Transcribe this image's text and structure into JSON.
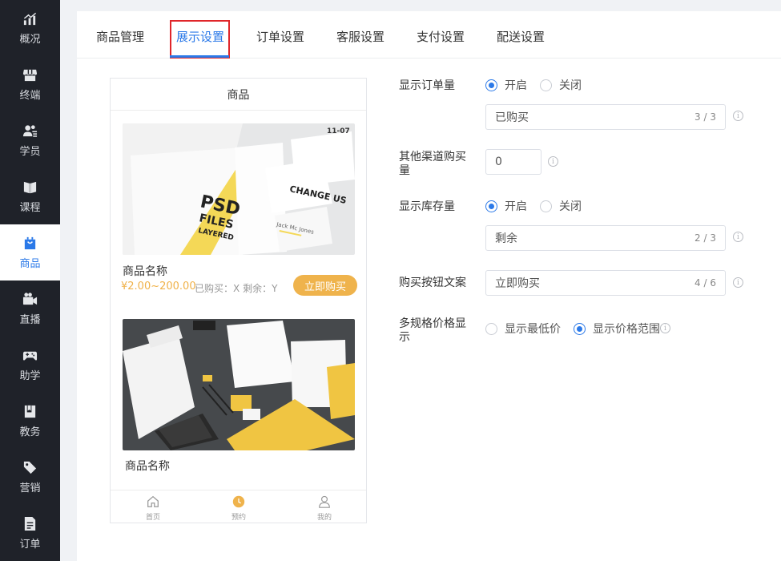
{
  "sidebar": {
    "items": [
      {
        "label": "概况",
        "icon": "chart-icon"
      },
      {
        "label": "终端",
        "icon": "store-icon"
      },
      {
        "label": "学员",
        "icon": "users-icon"
      },
      {
        "label": "课程",
        "icon": "book-icon"
      },
      {
        "label": "商品",
        "icon": "shopping-bag-icon",
        "active": true
      },
      {
        "label": "直播",
        "icon": "video-camera-icon"
      },
      {
        "label": "助学",
        "icon": "gamepad-icon"
      },
      {
        "label": "教务",
        "icon": "notebook-icon"
      },
      {
        "label": "营销",
        "icon": "tag-icon"
      },
      {
        "label": "订单",
        "icon": "document-icon"
      }
    ]
  },
  "tabs": [
    {
      "label": "商品管理"
    },
    {
      "label": "展示设置",
      "active": true
    },
    {
      "label": "订单设置"
    },
    {
      "label": "客服设置"
    },
    {
      "label": "支付设置"
    },
    {
      "label": "配送设置"
    }
  ],
  "preview": {
    "header": "商品",
    "products": [
      {
        "name": "商品名称",
        "price": "¥2.00~200.00",
        "sold": "已购买：X",
        "remaining": "剩余：Y",
        "buy_label": "立即购买"
      },
      {
        "name": "商品名称"
      }
    ],
    "image_text": {
      "psd1": "PSD",
      "psd2": "FILES",
      "psd3": "LAYERED",
      "card": "CHANGE US",
      "date": "11-07",
      "sig": "Jack Mc Jones"
    },
    "footer": [
      {
        "label": "首页",
        "icon": "home-icon"
      },
      {
        "label": "预约",
        "icon": "clock-icon"
      },
      {
        "label": "我的",
        "icon": "user-icon"
      }
    ]
  },
  "settings": {
    "show_order_count": {
      "label": "显示订单量",
      "options": [
        "开启",
        "关闭"
      ],
      "selected": "开启",
      "input_value": "已购买",
      "count": "3 / 3"
    },
    "other_channel": {
      "label": "其他渠道购买量",
      "value": "0"
    },
    "show_stock": {
      "label": "显示库存量",
      "options": [
        "开启",
        "关闭"
      ],
      "selected": "开启",
      "input_value": "剩余",
      "count": "2 / 3"
    },
    "buy_button_text": {
      "label": "购买按钮文案",
      "value": "立即购买",
      "count": "4 / 6"
    },
    "multi_spec_price": {
      "label": "多规格价格显示",
      "options": [
        "显示最低价",
        "显示价格范围"
      ],
      "selected": "显示价格范围"
    }
  },
  "colors": {
    "primary": "#2b79e8",
    "accent": "#efb34c",
    "sidebar": "#1f2229",
    "highlight_box": "#e0262a"
  }
}
